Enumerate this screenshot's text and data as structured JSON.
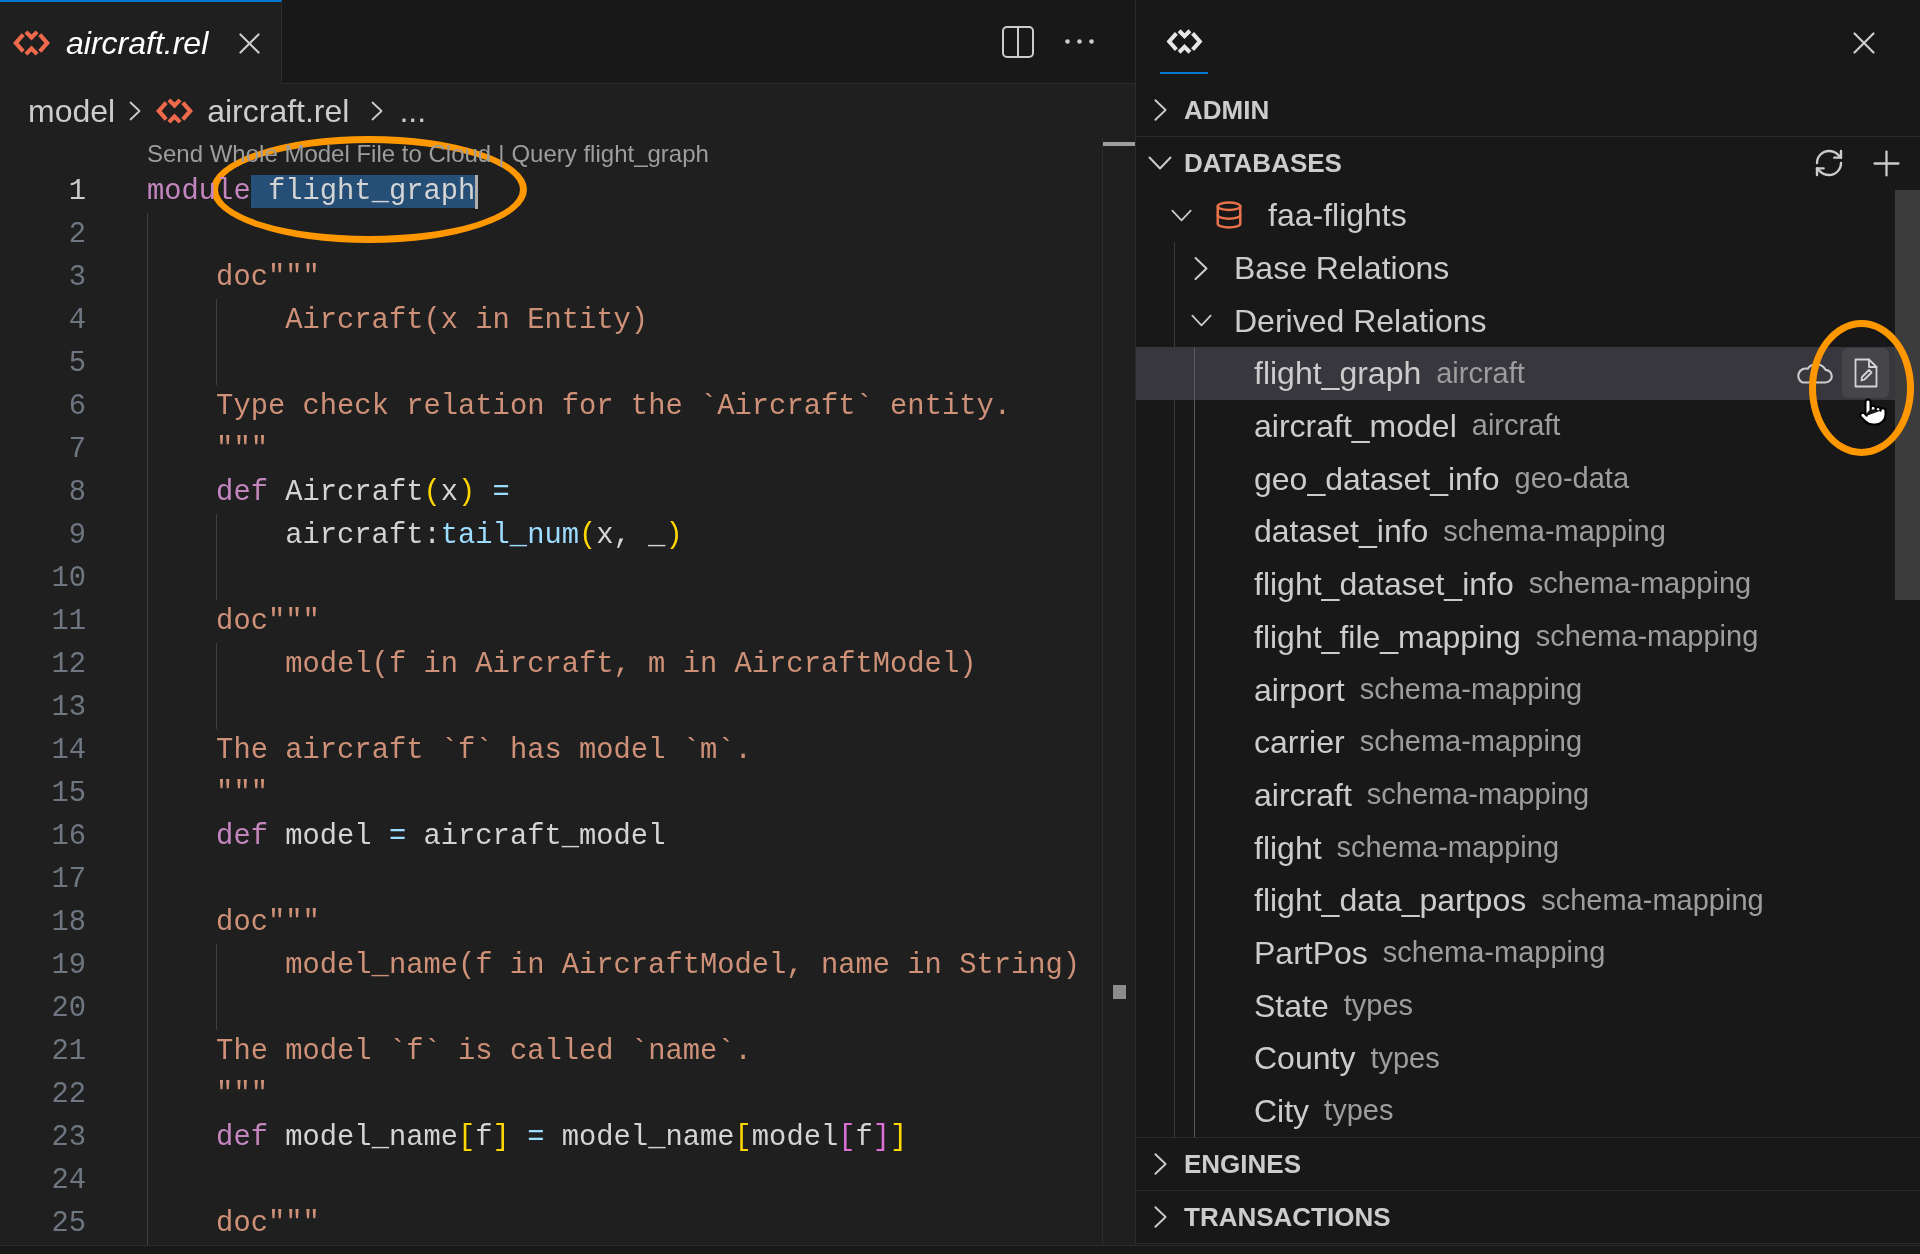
{
  "editor": {
    "tabs": [
      {
        "label": "aircraft.rel",
        "selected": true,
        "italic": true
      }
    ],
    "breadcrumb": [
      {
        "label": "model",
        "kind": "folder"
      },
      {
        "label": "aircraft.rel",
        "kind": "file"
      },
      {
        "label": "...",
        "kind": "more"
      }
    ],
    "code_lens": {
      "actions": [
        "Send Whole Model File to Cloud",
        "Query flight_graph"
      ],
      "separator": "|"
    },
    "lines": [
      {
        "number": "1",
        "current": true,
        "tokens": [
          {
            "kind": "keyword",
            "text": "module"
          },
          {
            "kind": "selection",
            "text": "flight_graph"
          }
        ]
      },
      {
        "number": "2",
        "current": false
      },
      {
        "number": "3",
        "current": false,
        "tokens": [
          {
            "kind": "string",
            "text": "    doc\"\"\""
          }
        ]
      },
      {
        "number": "4",
        "current": false,
        "tokens": [
          {
            "kind": "string",
            "text": "        Aircraft(x in Entity)"
          }
        ]
      },
      {
        "number": "5",
        "current": false
      },
      {
        "number": "6",
        "current": false,
        "tokens": [
          {
            "kind": "string",
            "text": "    Type check relation for the `Aircraft` entity."
          }
        ]
      },
      {
        "number": "7",
        "current": false,
        "tokens": [
          {
            "kind": "string",
            "text": "    \"\"\""
          }
        ]
      },
      {
        "number": "8",
        "current": false,
        "tokens": [
          {
            "kind": "keyword",
            "text": "    def"
          },
          {
            "kind": "ident",
            "text": " Aircraft"
          },
          {
            "kind": "bracket1",
            "text": "("
          },
          {
            "kind": "ident",
            "text": "x"
          },
          {
            "kind": "bracket1",
            "text": ")"
          },
          {
            "kind": "operator",
            "text": " ="
          }
        ]
      },
      {
        "number": "9",
        "current": false,
        "tokens": [
          {
            "kind": "ident",
            "text": "        aircraft:"
          },
          {
            "kind": "function",
            "text": "tail_num"
          },
          {
            "kind": "bracket1",
            "text": "("
          },
          {
            "kind": "ident",
            "text": "x, _"
          },
          {
            "kind": "bracket1",
            "text": ")"
          }
        ]
      },
      {
        "number": "10",
        "current": false
      },
      {
        "number": "11",
        "current": false,
        "tokens": [
          {
            "kind": "string",
            "text": "    doc\"\"\""
          }
        ]
      },
      {
        "number": "12",
        "current": false,
        "tokens": [
          {
            "kind": "string",
            "text": "        model(f in Aircraft, m in AircraftModel)"
          }
        ]
      },
      {
        "number": "13",
        "current": false
      },
      {
        "number": "14",
        "current": false,
        "tokens": [
          {
            "kind": "string",
            "text": "    The aircraft `f` has model `m`."
          }
        ]
      },
      {
        "number": "15",
        "current": false,
        "tokens": [
          {
            "kind": "string",
            "text": "    \"\"\""
          }
        ]
      },
      {
        "number": "16",
        "current": false,
        "tokens": [
          {
            "kind": "keyword",
            "text": "    def"
          },
          {
            "kind": "ident",
            "text": " model "
          },
          {
            "kind": "operator",
            "text": "="
          },
          {
            "kind": "ident",
            "text": " aircraft_model"
          }
        ]
      },
      {
        "number": "17",
        "current": false
      },
      {
        "number": "18",
        "current": false,
        "tokens": [
          {
            "kind": "string",
            "text": "    doc\"\"\""
          }
        ]
      },
      {
        "number": "19",
        "current": false,
        "tokens": [
          {
            "kind": "string",
            "text": "        model_name(f in AircraftModel, name in String)"
          }
        ]
      },
      {
        "number": "20",
        "current": false
      },
      {
        "number": "21",
        "current": false,
        "tokens": [
          {
            "kind": "string",
            "text": "    The model `f` is called `name`."
          }
        ]
      },
      {
        "number": "22",
        "current": false,
        "tokens": [
          {
            "kind": "string",
            "text": "    \"\"\""
          }
        ]
      },
      {
        "number": "23",
        "current": false,
        "tokens": [
          {
            "kind": "keyword",
            "text": "    def"
          },
          {
            "kind": "ident",
            "text": " model_name"
          },
          {
            "kind": "bracket1",
            "text": "["
          },
          {
            "kind": "ident",
            "text": "f"
          },
          {
            "kind": "bracket1",
            "text": "]"
          },
          {
            "kind": "operator",
            "text": " ="
          },
          {
            "kind": "ident",
            "text": " model_name"
          },
          {
            "kind": "bracket1",
            "text": "["
          },
          {
            "kind": "ident",
            "text": "model"
          },
          {
            "kind": "bracket2",
            "text": "["
          },
          {
            "kind": "ident",
            "text": "f"
          },
          {
            "kind": "bracket2",
            "text": "]"
          },
          {
            "kind": "bracket1",
            "text": "]"
          }
        ]
      },
      {
        "number": "24",
        "current": false
      },
      {
        "number": "25",
        "current": false,
        "tokens": [
          {
            "kind": "string",
            "text": "    doc\"\"\""
          }
        ]
      }
    ]
  },
  "panel": {
    "tabs": [
      {
        "selected": true
      }
    ],
    "sections": [
      {
        "title": "ADMIN",
        "expanded": false
      },
      {
        "title": "DATABASES",
        "expanded": true,
        "children": [
          {
            "label": "faa-flights",
            "kind": "database",
            "expanded": true,
            "children": [
              {
                "label": "Base Relations",
                "expanded": false
              },
              {
                "label": "Derived Relations",
                "expanded": true,
                "children": [
                  {
                    "label": "flight_graph",
                    "description": "aircraft",
                    "selected": true
                  },
                  {
                    "label": "aircraft_model",
                    "description": "aircraft",
                    "selected": false
                  },
                  {
                    "label": "geo_dataset_info",
                    "description": "geo-data",
                    "selected": false
                  },
                  {
                    "label": "dataset_info",
                    "description": "schema-mapping",
                    "selected": false
                  },
                  {
                    "label": "flight_dataset_info",
                    "description": "schema-mapping",
                    "selected": false
                  },
                  {
                    "label": "flight_file_mapping",
                    "description": "schema-mapping",
                    "selected": false
                  },
                  {
                    "label": "airport",
                    "description": "schema-mapping",
                    "selected": false
                  },
                  {
                    "label": "carrier",
                    "description": "schema-mapping",
                    "selected": false
                  },
                  {
                    "label": "aircraft",
                    "description": "schema-mapping",
                    "selected": false
                  },
                  {
                    "label": "flight",
                    "description": "schema-mapping",
                    "selected": false
                  },
                  {
                    "label": "flight_data_partpos",
                    "description": "schema-mapping",
                    "selected": false
                  },
                  {
                    "label": "PartPos",
                    "description": "schema-mapping",
                    "selected": false
                  },
                  {
                    "label": "State",
                    "description": "types",
                    "selected": false
                  },
                  {
                    "label": "County",
                    "description": "types",
                    "selected": false
                  },
                  {
                    "label": "City",
                    "description": "types",
                    "selected": false
                  }
                ]
              }
            ]
          }
        ]
      },
      {
        "title": "ENGINES",
        "expanded": false
      },
      {
        "title": "TRANSACTIONS",
        "expanded": false
      }
    ]
  }
}
